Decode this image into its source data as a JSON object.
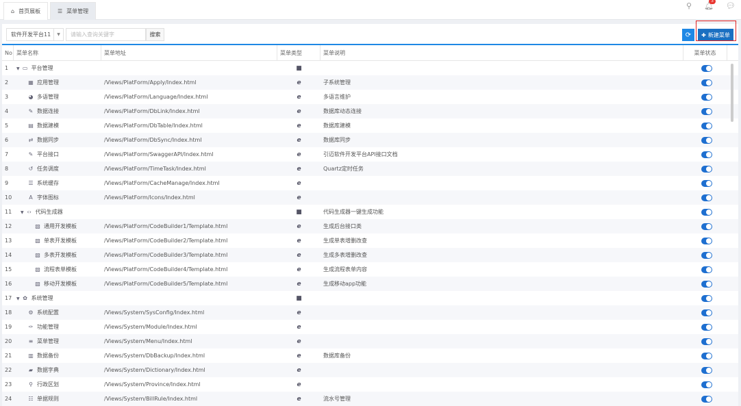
{
  "tabs": [
    {
      "icon": "home-icon",
      "label": "首页展板"
    },
    {
      "icon": "menu-icon",
      "label": "菜单管理"
    }
  ],
  "notifications": {
    "count": "3"
  },
  "toolbar": {
    "platform": "软件开发平台11",
    "search_placeholder": "请输入查询关键字",
    "search_label": "搜索",
    "new_label": "新建菜单"
  },
  "columns": {
    "no": "No",
    "name": "菜单名称",
    "url": "菜单地址",
    "type": "菜单类型",
    "desc": "菜单说明",
    "status": "菜单状态"
  },
  "colors": {
    "accent": "#1e88e5",
    "toggle": "#1e6fd0",
    "highlight": "#e02020"
  },
  "rows": [
    {
      "no": "1",
      "level": 0,
      "caret": true,
      "icon": "▭",
      "name": "平台管理",
      "url": "",
      "type": "folder",
      "desc": ""
    },
    {
      "no": "2",
      "level": 1,
      "icon": "▦",
      "name": "应用管理",
      "url": "/Views/PlatForm/Apply/Index.html",
      "type": "page",
      "desc": "子系统管理"
    },
    {
      "no": "3",
      "level": 1,
      "icon": "◕",
      "name": "多语管理",
      "url": "/Views/PlatForm/Language/Index.html",
      "type": "page",
      "desc": "多语言维护"
    },
    {
      "no": "4",
      "level": 1,
      "icon": "✎",
      "name": "数据连接",
      "url": "/Views/PlatForm/DbLink/Index.html",
      "type": "page",
      "desc": "数据库动态连接"
    },
    {
      "no": "5",
      "level": 1,
      "icon": "▤",
      "name": "数据建模",
      "url": "/Views/PlatForm/DbTable/Index.html",
      "type": "page",
      "desc": "数据库建模"
    },
    {
      "no": "6",
      "level": 1,
      "icon": "⇄",
      "name": "数据同步",
      "url": "/Views/PlatForm/DbSync/Index.html",
      "type": "page",
      "desc": "数据库同步"
    },
    {
      "no": "7",
      "level": 1,
      "icon": "✎",
      "name": "平台接口",
      "url": "/Views/PlatForm/SwaggerAPI/Index.html",
      "type": "page",
      "desc": "引迈软件开发平台API接口文档"
    },
    {
      "no": "8",
      "level": 1,
      "icon": "↺",
      "name": "任务调度",
      "url": "/Views/PlatForm/TimeTask/Index.html",
      "type": "page",
      "desc": "Quartz定时任务"
    },
    {
      "no": "9",
      "level": 1,
      "icon": "☰",
      "name": "系统缓存",
      "url": "/Views/PlatForm/CacheManage/Index.html",
      "type": "page",
      "desc": ""
    },
    {
      "no": "10",
      "level": 1,
      "icon": "A",
      "name": "字体图标",
      "url": "/Views/PlatForm/Icons/Index.html",
      "type": "page",
      "desc": ""
    },
    {
      "no": "11",
      "level": 0.5,
      "caret": true,
      "icon": "‹›",
      "name": "代码生成器",
      "url": "",
      "type": "folder",
      "desc": "代码生成器一键生成功能"
    },
    {
      "no": "12",
      "level": 2,
      "icon": "▧",
      "name": "通用开发模板",
      "url": "/Views/PlatForm/CodeBuilder1/Template.html",
      "type": "page",
      "desc": "生成后台接口类"
    },
    {
      "no": "13",
      "level": 2,
      "icon": "▧",
      "name": "单表开发模板",
      "url": "/Views/PlatForm/CodeBuilder2/Template.html",
      "type": "page",
      "desc": "生成单表增删改查"
    },
    {
      "no": "14",
      "level": 2,
      "icon": "▧",
      "name": "多表开发模板",
      "url": "/Views/PlatForm/CodeBuilder3/Template.html",
      "type": "page",
      "desc": "生成多表增删改查"
    },
    {
      "no": "15",
      "level": 2,
      "icon": "▧",
      "name": "流程表单模板",
      "url": "/Views/PlatForm/CodeBuilder4/Template.html",
      "type": "page",
      "desc": "生成流程表单内容"
    },
    {
      "no": "16",
      "level": 2,
      "icon": "▧",
      "name": "移动开发模板",
      "url": "/Views/PlatForm/CodeBuilder5/Template.html",
      "type": "page",
      "desc": "生成移动app功能"
    },
    {
      "no": "17",
      "level": 0,
      "caret": true,
      "icon": "✿",
      "name": "系统管理",
      "url": "",
      "type": "folder",
      "desc": ""
    },
    {
      "no": "18",
      "level": 1,
      "icon": "⚙",
      "name": "系统配置",
      "url": "/Views/System/SysConfig/Index.html",
      "type": "page",
      "desc": ""
    },
    {
      "no": "19",
      "level": 1,
      "icon": "✑",
      "name": "功能管理",
      "url": "/Views/System/Module/Index.html",
      "type": "page",
      "desc": ""
    },
    {
      "no": "20",
      "level": 1,
      "icon": "≡",
      "name": "菜单管理",
      "url": "/Views/System/Menu/Index.html",
      "type": "page",
      "desc": ""
    },
    {
      "no": "21",
      "level": 1,
      "icon": "▥",
      "name": "数据备份",
      "url": "/Views/System/DbBackup/Index.html",
      "type": "page",
      "desc": "数据库备份"
    },
    {
      "no": "22",
      "level": 1,
      "icon": "▰",
      "name": "数据字典",
      "url": "/Views/System/Dictionary/Index.html",
      "type": "page",
      "desc": ""
    },
    {
      "no": "23",
      "level": 1,
      "icon": "⚲",
      "name": "行政区划",
      "url": "/Views/System/Province/Index.html",
      "type": "page",
      "desc": ""
    },
    {
      "no": "24",
      "level": 1,
      "icon": "☷",
      "name": "单据规则",
      "url": "/Views/System/BillRule/Index.html",
      "type": "page",
      "desc": "流水号管理"
    }
  ]
}
